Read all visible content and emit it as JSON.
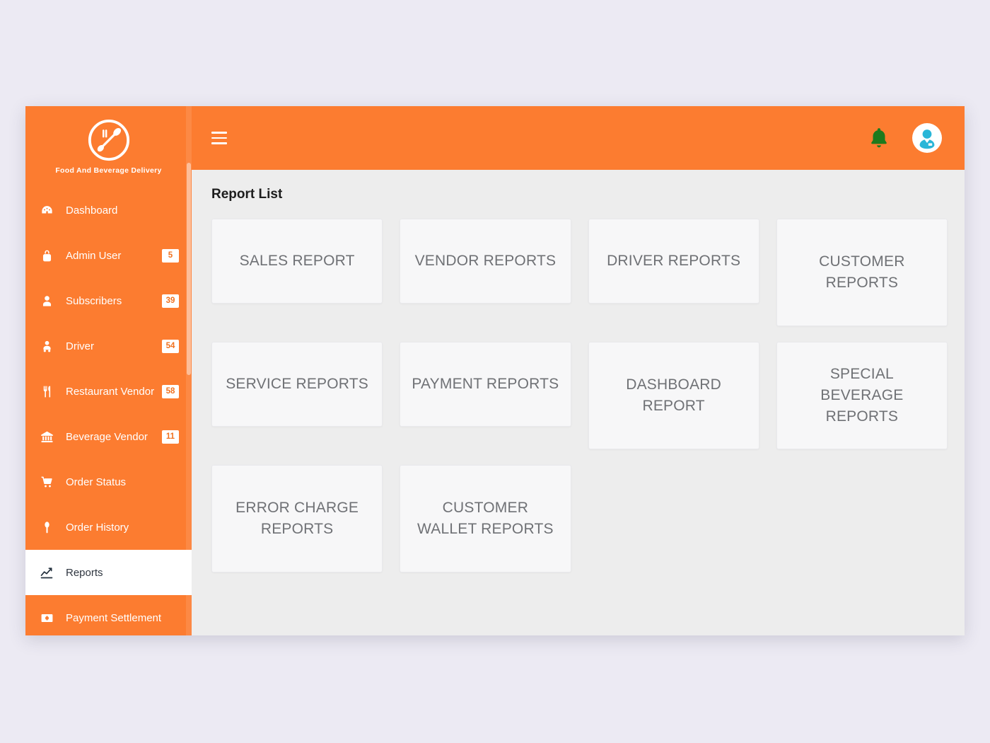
{
  "brand": {
    "title": "Food And Beverage Delivery",
    "logo_icon": "fork-spoon-circle-logo"
  },
  "sidebar": {
    "items": [
      {
        "label": "Dashboard",
        "icon": "dashboard-gauge-icon",
        "badge": "",
        "active": false
      },
      {
        "label": "Admin User",
        "icon": "user-lock-icon",
        "badge": "5",
        "active": false
      },
      {
        "label": "Subscribers",
        "icon": "user-icon",
        "badge": "39",
        "active": false
      },
      {
        "label": "Driver",
        "icon": "driver-icon",
        "badge": "54",
        "active": false
      },
      {
        "label": "Restaurant Vendor",
        "icon": "fork-knife-icon",
        "badge": "58",
        "active": false
      },
      {
        "label": "Beverage Vendor",
        "icon": "bank-icon",
        "badge": "11",
        "active": false
      },
      {
        "label": "Order Status",
        "icon": "shopping-cart-icon",
        "badge": "",
        "active": false
      },
      {
        "label": "Order History",
        "icon": "spoon-icon",
        "badge": "",
        "active": false
      },
      {
        "label": "Reports",
        "icon": "chart-line-icon",
        "badge": "",
        "active": true
      },
      {
        "label": "Payment Settlement",
        "icon": "money-bill-icon",
        "badge": "",
        "active": false
      }
    ]
  },
  "topbar": {
    "menu_toggle_icon": "hamburger-icon",
    "notification_icon": "bell-icon",
    "avatar_icon": "user-avatar-icon"
  },
  "main": {
    "page_title": "Report List",
    "cards": [
      {
        "label": "SALES REPORT",
        "tall": false
      },
      {
        "label": "VENDOR REPORTS",
        "tall": false
      },
      {
        "label": "DRIVER REPORTS",
        "tall": false
      },
      {
        "label": "CUSTOMER REPORTS",
        "tall": true
      },
      {
        "label": "SERVICE REPORTS",
        "tall": false
      },
      {
        "label": "PAYMENT REPORTS",
        "tall": false
      },
      {
        "label": "DASHBOARD REPORT",
        "tall": true
      },
      {
        "label": "SPECIAL BEVERAGE REPORTS",
        "tall": true
      },
      {
        "label": "ERROR CHARGE REPORTS",
        "tall": true
      },
      {
        "label": "CUSTOMER WALLET REPORTS",
        "tall": true
      }
    ]
  },
  "colors": {
    "brand_orange": "#fc7c30",
    "page_background": "#eceaf3",
    "content_background": "#ededed",
    "card_background": "#f7f7f8",
    "card_text": "#6f7175",
    "bell_green": "#1d7a1d",
    "avatar_cyan": "#29b6d8"
  }
}
